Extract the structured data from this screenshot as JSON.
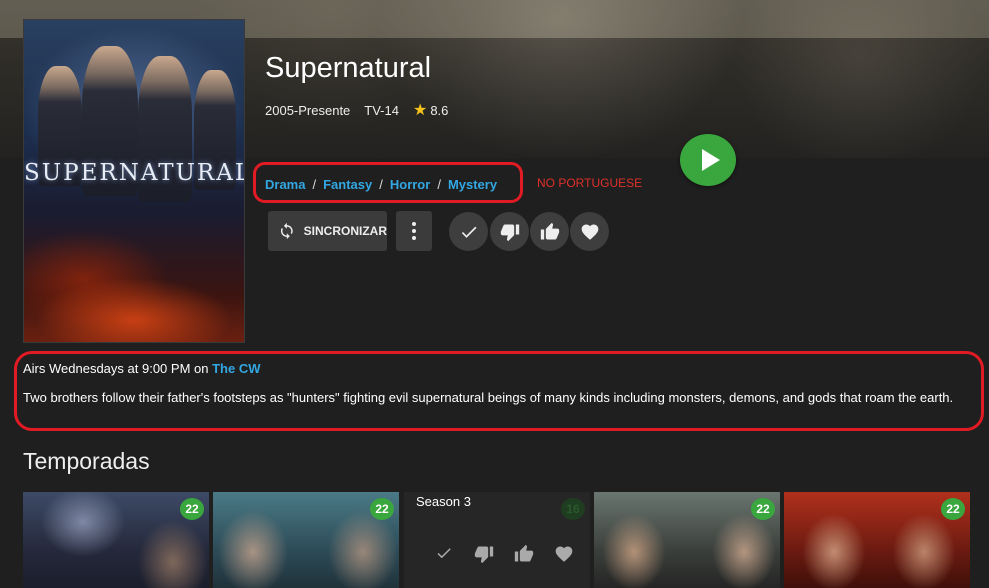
{
  "show": {
    "title": "Supernatural",
    "years": "2005-Presente",
    "rating": "TV-14",
    "score": "8.6",
    "poster_title": "SUPERNATURAL"
  },
  "genres": [
    "Drama",
    "Fantasy",
    "Horror",
    "Mystery"
  ],
  "genre_separator": "/",
  "note": "NO PORTUGUESE",
  "actions": {
    "sync_label": "SINCRONIZAR"
  },
  "info": {
    "airs_prefix": "Airs Wednesdays at 9:00 PM on",
    "network": "The CW",
    "description": "Two brothers follow their father's footsteps as \"hunters\" fighting evil supernatural beings of many kinds including monsters, demons, and gods that roam the earth."
  },
  "seasons": {
    "heading": "Temporadas",
    "cards": [
      {
        "count": "22",
        "label": ""
      },
      {
        "count": "22",
        "label": ""
      },
      {
        "count": "16",
        "label": "Season 3"
      },
      {
        "count": "22",
        "label": ""
      },
      {
        "count": "22",
        "label": ""
      }
    ]
  },
  "colors": {
    "accent": "#33a7e3",
    "play": "#3aa63e",
    "annotation": "#e01b24",
    "note": "#e0302a"
  },
  "icons": [
    "play-icon",
    "star-icon",
    "sync-icon",
    "more-vert-icon",
    "check-icon",
    "thumbs-down-icon",
    "thumbs-up-icon",
    "heart-icon"
  ]
}
